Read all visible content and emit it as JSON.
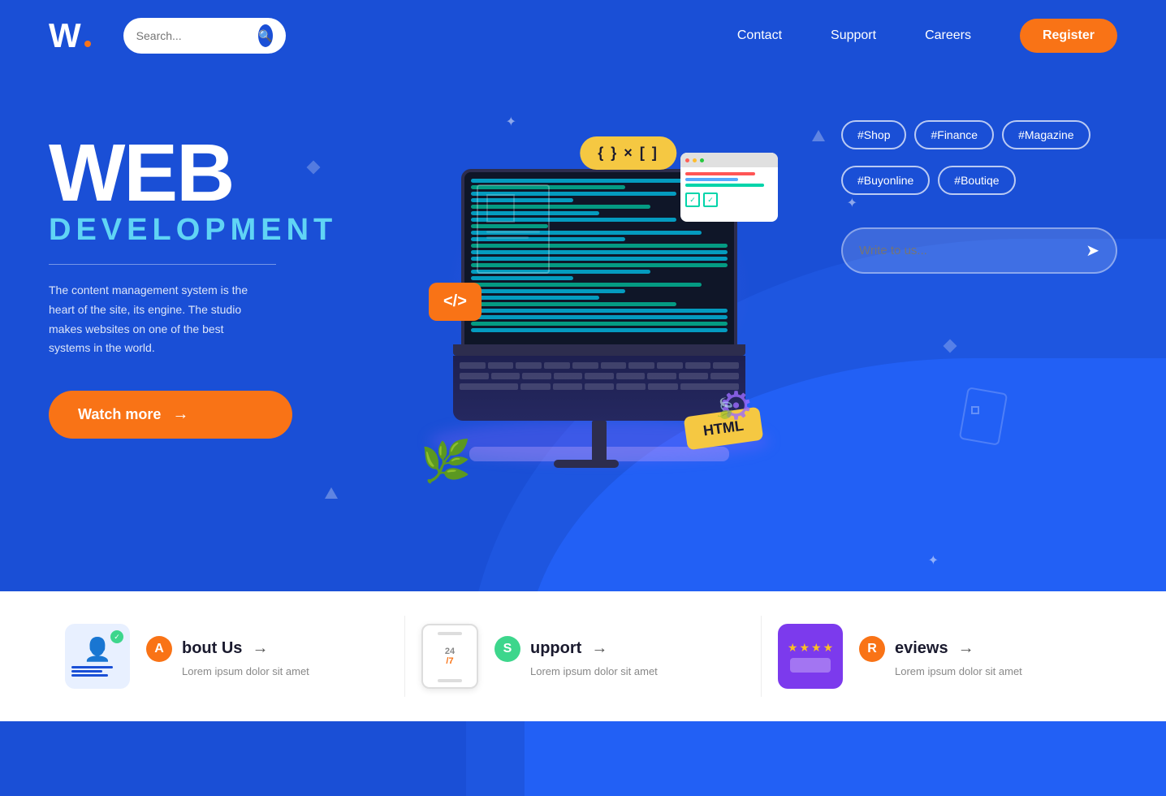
{
  "header": {
    "logo": "W.",
    "logo_letter": "W",
    "search_placeholder": "Search...",
    "nav_items": [
      "Contact",
      "Support",
      "Careers"
    ],
    "register_label": "Register"
  },
  "hero": {
    "title_line1": "WEB",
    "title_line2": "DEVELOPMENT",
    "description": "The content management system is the heart of the site, its engine. The studio makes websites on one of the best systems in the world.",
    "cta_label": "Watch more",
    "tags": [
      "#Shop",
      "#Finance",
      "#Magazine",
      "#Buyonline",
      "#Boutiqe"
    ],
    "write_us_placeholder": "Write to us..."
  },
  "bottom": {
    "cards": [
      {
        "letter": "A",
        "name": "bout Us",
        "full_name": "About Us",
        "desc": "Lorem ipsum dolor sit amet"
      },
      {
        "letter": "S",
        "name": "upport",
        "full_name": "Support",
        "desc": "Lorem ipsum dolor sit amet"
      },
      {
        "letter": "R",
        "name": "eviews",
        "full_name": "Reviews",
        "desc": "Lorem ipsum dolor sit amet"
      }
    ]
  },
  "decorative": {
    "code_bracket_label": "{ } × [ ]",
    "html_label": "HTML",
    "code_tag_label": "</>",
    "arrow": "→"
  }
}
